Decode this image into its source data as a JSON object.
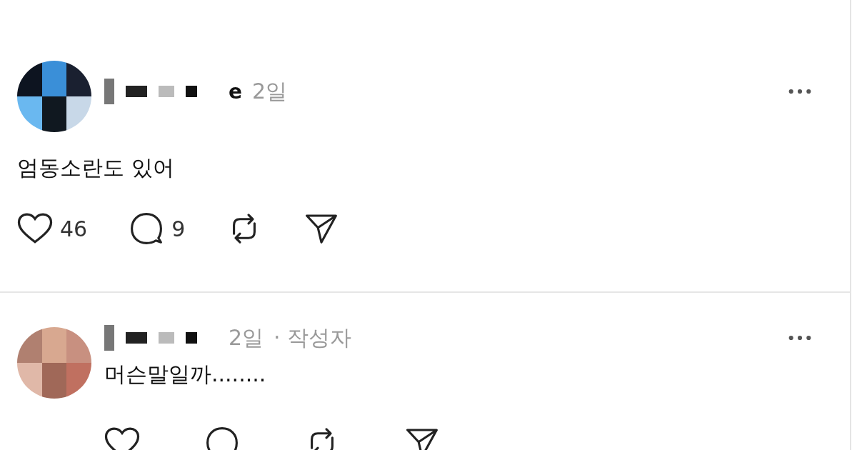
{
  "posts": [
    {
      "name_tail": "e",
      "time": "2일",
      "text": "엄동소란도 있어",
      "likes": "46",
      "comments": "9"
    },
    {
      "time": "2일",
      "author_badge": "· 작성자",
      "text": "머슨말일까........"
    }
  ]
}
